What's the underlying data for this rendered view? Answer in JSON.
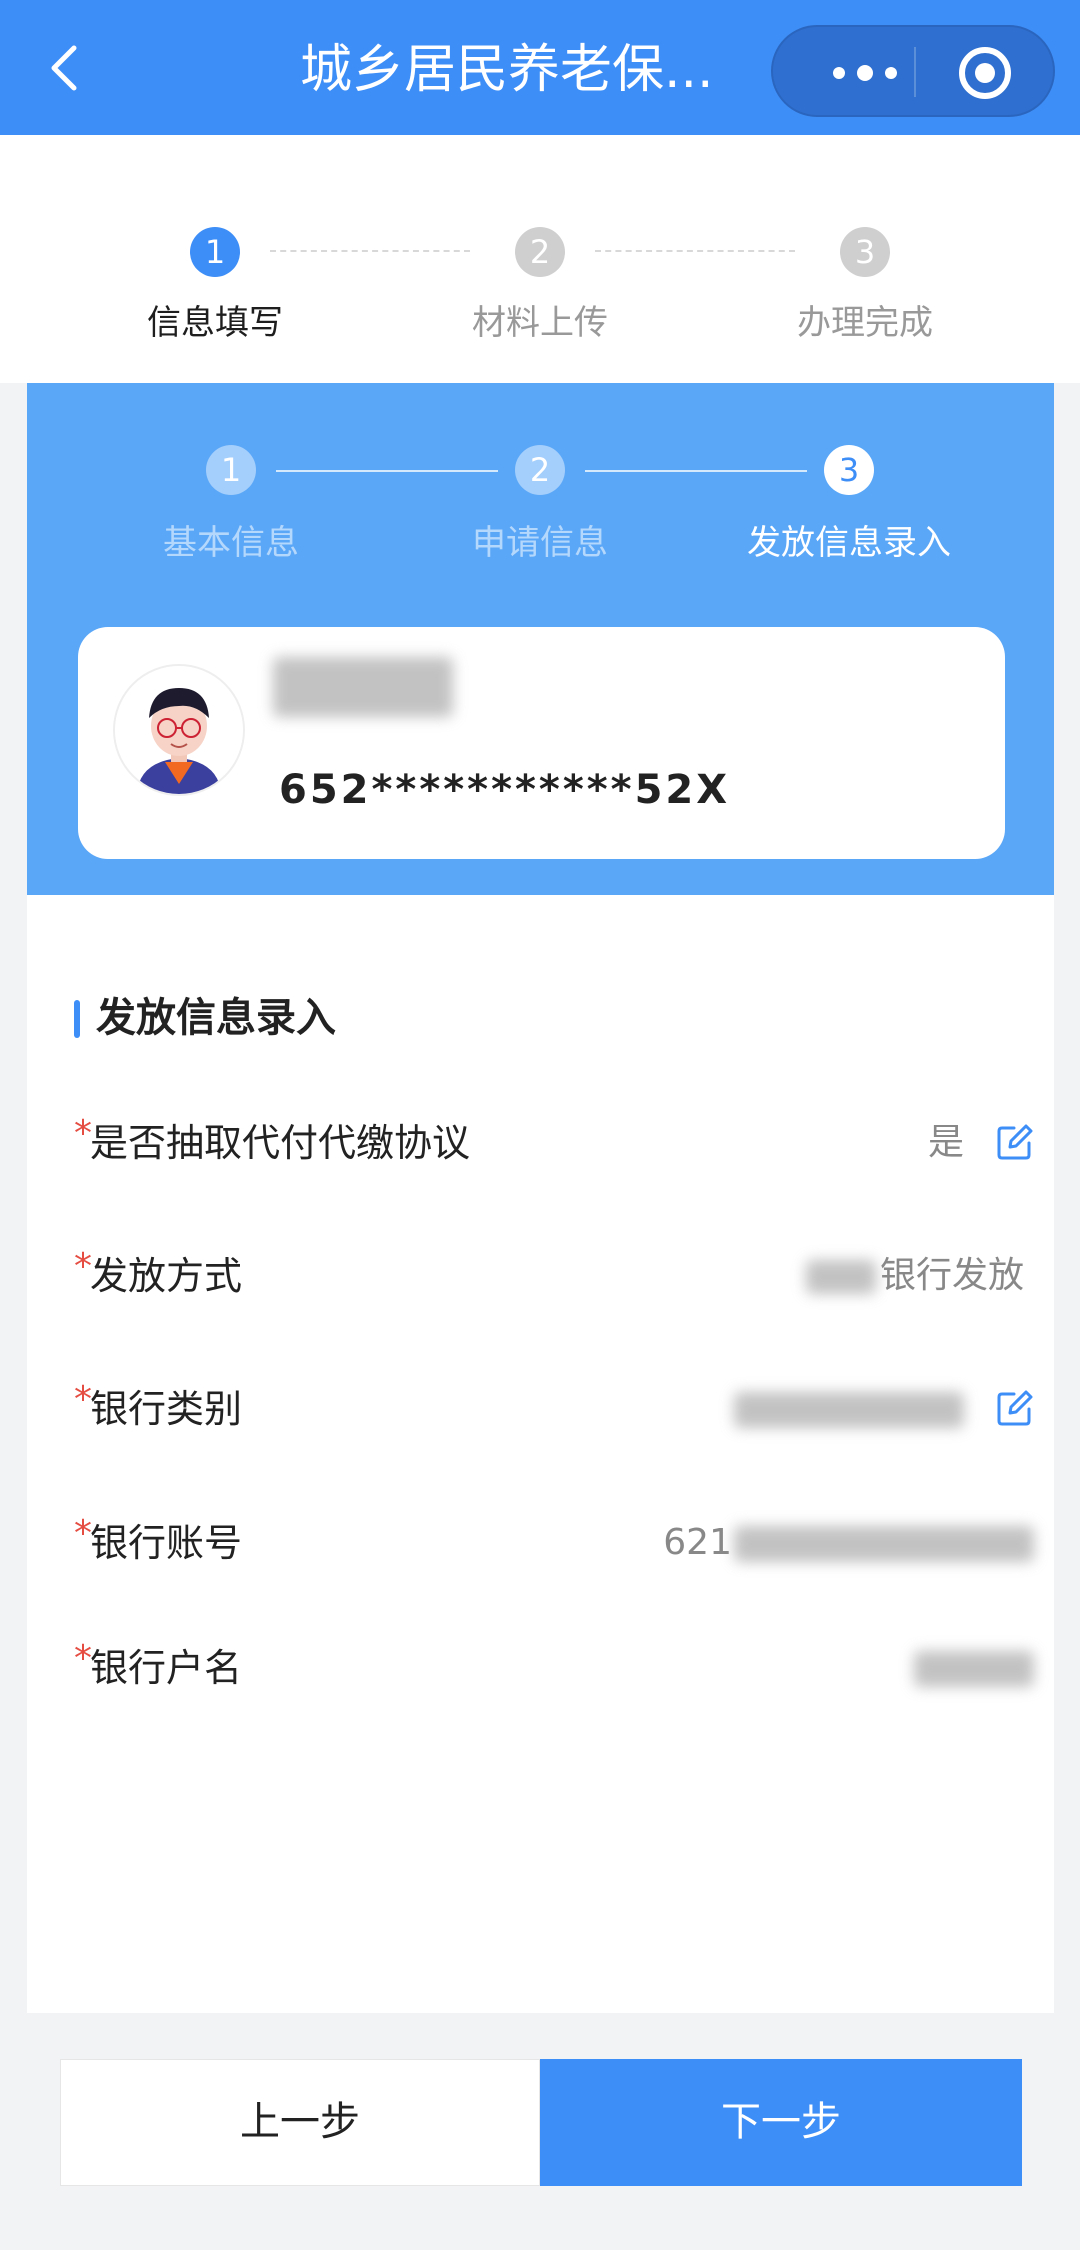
{
  "navbar": {
    "title": "城乡居民养老保..."
  },
  "progress": [
    {
      "num": "1",
      "label": "信息填写"
    },
    {
      "num": "2",
      "label": "材料上传"
    },
    {
      "num": "3",
      "label": "办理完成"
    }
  ],
  "sub_steps": [
    {
      "num": "1",
      "label": "基本信息"
    },
    {
      "num": "2",
      "label": "申请信息"
    },
    {
      "num": "3",
      "label": "发放信息录入"
    }
  ],
  "person": {
    "id_number": "652***********52X"
  },
  "section": {
    "title": "发放信息录入"
  },
  "form": [
    {
      "label": "是否抽取代付代缴协议",
      "value": "是",
      "required": "*"
    },
    {
      "label": "发放方式",
      "value": "银行发放",
      "required": "*"
    },
    {
      "label": "银行类别",
      "value": "",
      "required": "*"
    },
    {
      "label": "银行账号",
      "value": "621",
      "required": "*"
    },
    {
      "label": "银行户名",
      "value": "",
      "required": "*"
    }
  ],
  "buttons": {
    "prev": "上一步",
    "next": "下一步"
  },
  "colors": {
    "primary": "#3e8ef7",
    "blue_panel": "#5aa7f8",
    "required": "#e54d42"
  }
}
